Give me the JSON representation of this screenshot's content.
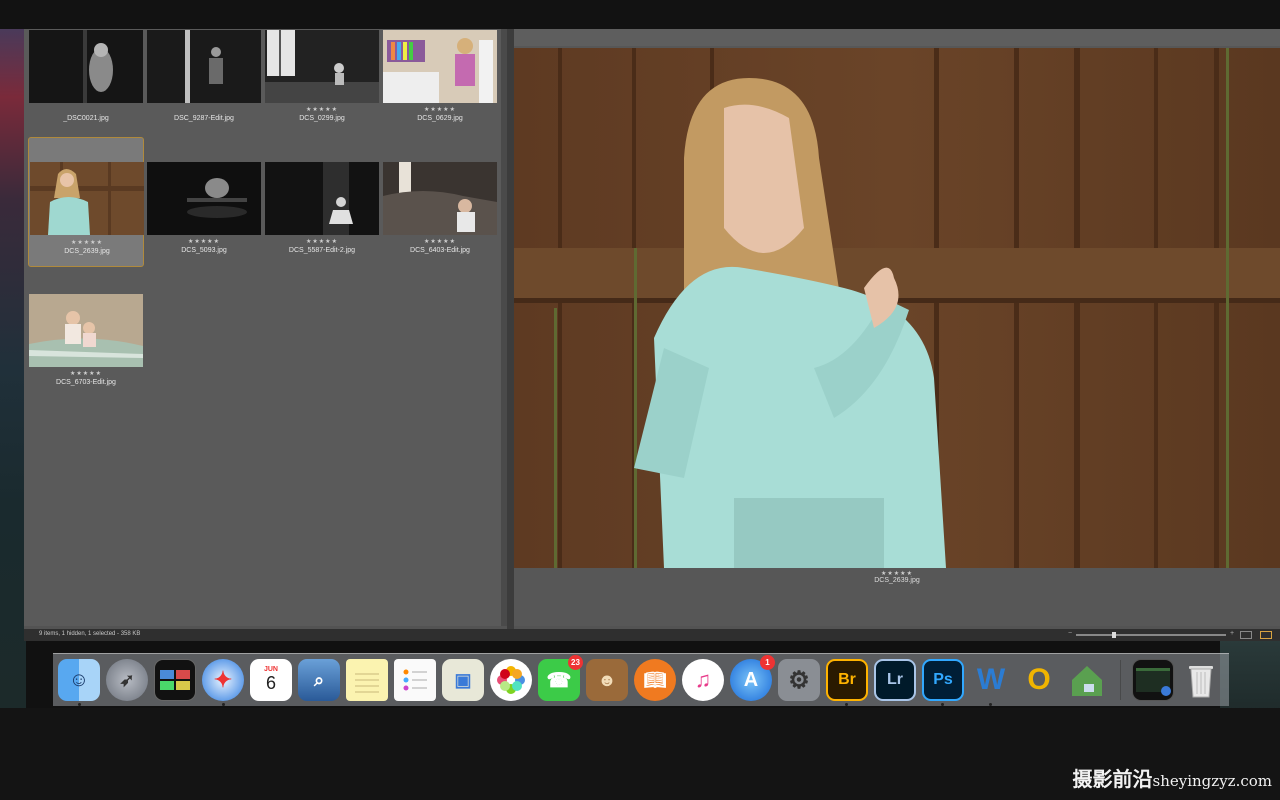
{
  "browser": {
    "thumbnails": [
      {
        "filename": "_DSC0021.jpg",
        "stars": "",
        "selected": false
      },
      {
        "filename": "DSC_9287-Edit.jpg",
        "stars": "",
        "selected": false
      },
      {
        "filename": "DCS_0299.jpg",
        "stars": "★★★★★",
        "selected": false
      },
      {
        "filename": "DCS_0629.jpg",
        "stars": "★★★★★",
        "selected": false
      },
      {
        "filename": "DCS_2639.jpg",
        "stars": "★★★★★",
        "selected": true
      },
      {
        "filename": "DCS_5093.jpg",
        "stars": "★★★★★",
        "selected": false
      },
      {
        "filename": "DCS_5587-Edit-2.jpg",
        "stars": "★★★★★",
        "selected": false
      },
      {
        "filename": "DCS_6403-Edit.jpg",
        "stars": "★★★★★",
        "selected": false
      },
      {
        "filename": "DCS_6703-Edit.jpg",
        "stars": "★★★★★",
        "selected": false
      }
    ]
  },
  "preview": {
    "stars": "★★★★★",
    "filename": "DCS_2639.jpg"
  },
  "statusbar": {
    "text": "9 items, 1 hidden, 1 selected - 358 KB",
    "zoom_minus": "−",
    "zoom_plus": "+"
  },
  "dock": {
    "calendar_month": "JUN",
    "calendar_day": "6",
    "facetime_badge": "23",
    "appstore_badge": "1",
    "bridge_label": "Br",
    "lightroom_label": "Lr",
    "photoshop_label": "Ps",
    "word_label": "W",
    "outlook_label": "O",
    "colors": {
      "bridge": "#ffb300",
      "lightroom": "#a9c5e8",
      "photoshop": "#31a8ff",
      "selection_border": "#b08a3c"
    }
  },
  "watermark": {
    "cn": "摄影前沿",
    "url": "sheyingzyz.com"
  }
}
